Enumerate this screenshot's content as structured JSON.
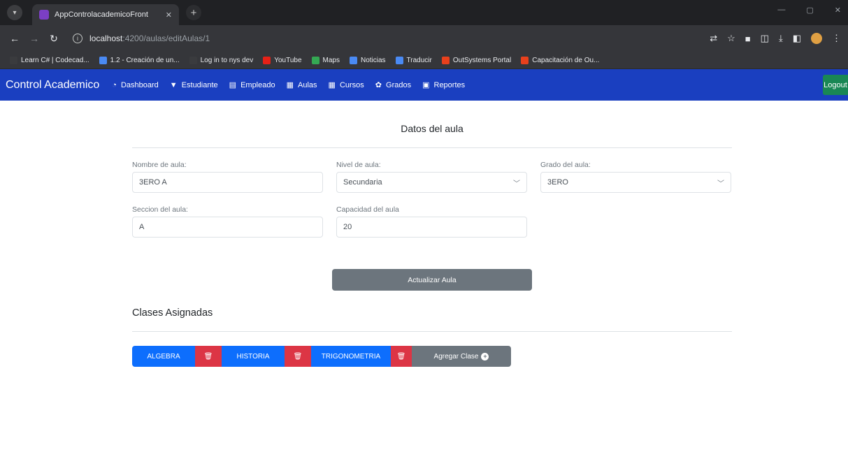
{
  "browser": {
    "tab_title": "AppControlacademicoFront",
    "url_host": "localhost",
    "url_path": ":4200/aulas/editAulas/1",
    "bookmarks": [
      {
        "label": "Learn C# | Codecad...",
        "color": "#3a3b3e"
      },
      {
        "label": "1.2 - Creación de un...",
        "color": "#4a8af4"
      },
      {
        "label": "Log in to nys dev",
        "color": "#3a3b3e"
      },
      {
        "label": "YouTube",
        "color": "#e62117"
      },
      {
        "label": "Maps",
        "color": "#34a853"
      },
      {
        "label": "Noticias",
        "color": "#4a8af4"
      },
      {
        "label": "Traducir",
        "color": "#4a8af4"
      },
      {
        "label": "OutSystems Portal",
        "color": "#e8401c"
      },
      {
        "label": "Capacitación de Ou...",
        "color": "#e8401c"
      }
    ]
  },
  "navbar": {
    "brand": "Control Academico",
    "links": [
      {
        "label": "Dashboard",
        "icon": "dashboard-icon"
      },
      {
        "label": "Estudiante",
        "icon": "student-icon"
      },
      {
        "label": "Empleado",
        "icon": "employee-icon"
      },
      {
        "label": "Aulas",
        "icon": "classroom-icon"
      },
      {
        "label": "Cursos",
        "icon": "courses-icon"
      },
      {
        "label": "Grados",
        "icon": "grades-icon"
      },
      {
        "label": "Reportes",
        "icon": "reports-icon"
      }
    ],
    "logout": "Logout",
    "color": "#1a3fc0"
  },
  "form": {
    "title": "Datos del aula",
    "nombre_label": "Nombre de aula:",
    "nombre_value": "3ERO A",
    "nivel_label": "Nivel de aula:",
    "nivel_value": "Secundaria",
    "grado_label": "Grado del aula:",
    "grado_value": "3ERO",
    "seccion_label": "Seccion del aula:",
    "seccion_value": "A",
    "capacidad_label": "Capacidad del aula",
    "capacidad_value": "20",
    "update_button": "Actualizar Aula"
  },
  "classes": {
    "title": "Clases Asignadas",
    "items": [
      {
        "name": "ALGEBRA"
      },
      {
        "name": "HISTORIA"
      },
      {
        "name": "TRIGONOMETRIA"
      }
    ],
    "add_button": "Agregar Clase"
  }
}
